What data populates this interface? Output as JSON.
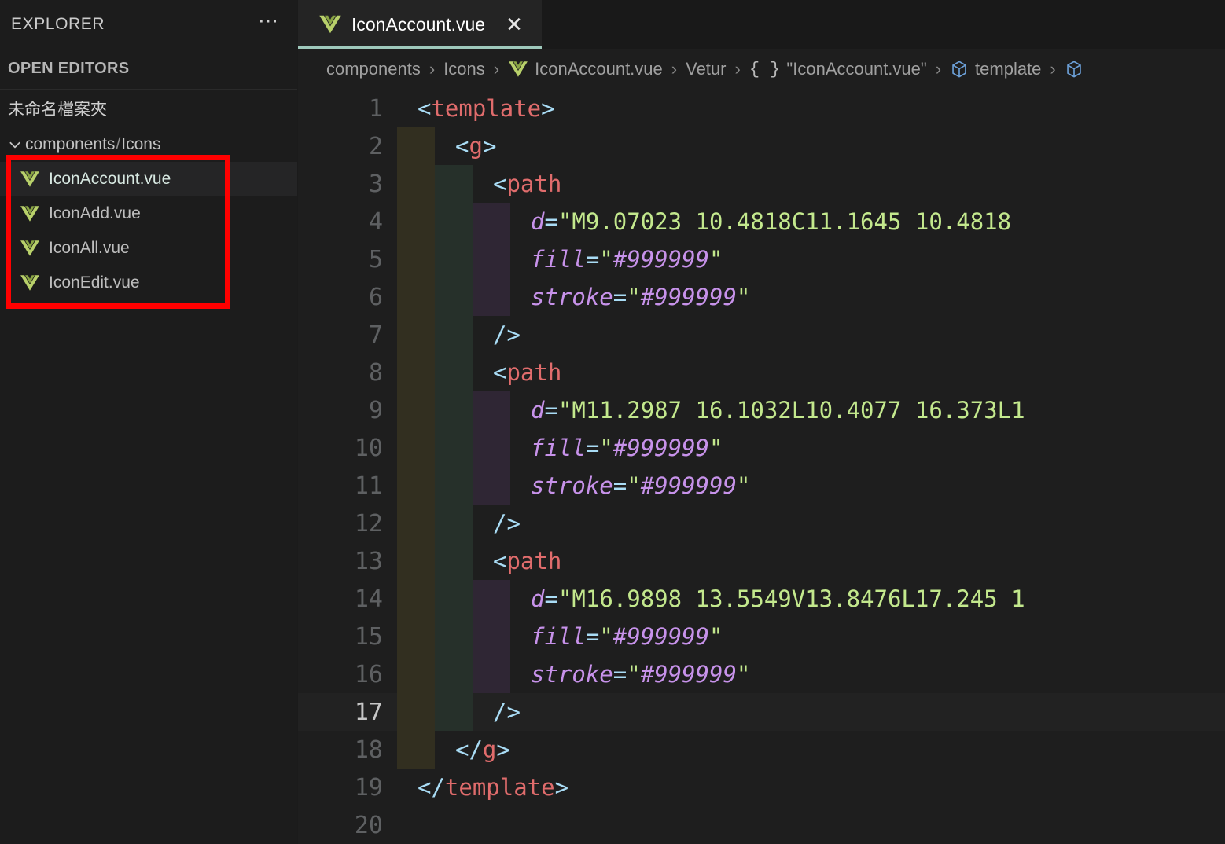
{
  "sidebar": {
    "title": "EXPLORER",
    "more_icon": "ellipsis-icon",
    "open_editors_label": "OPEN EDITORS",
    "workspace_label": "未命名檔案夾",
    "group": {
      "name": "components",
      "separator": "/",
      "subname": "Icons"
    },
    "files": [
      {
        "name": "IconAccount.vue",
        "icon": "vue-icon",
        "selected": true
      },
      {
        "name": "IconAdd.vue",
        "icon": "vue-icon",
        "selected": false
      },
      {
        "name": "IconAll.vue",
        "icon": "vue-icon",
        "selected": false
      },
      {
        "name": "IconEdit.vue",
        "icon": "vue-icon",
        "selected": false
      }
    ]
  },
  "annotation": {
    "shape": "rectangle",
    "color": "#ff0000"
  },
  "tab": {
    "label": "IconAccount.vue",
    "icon": "vue-icon",
    "close_icon": "✕",
    "active_border_color": "#9fc9bc"
  },
  "breadcrumbs": [
    {
      "label": "components",
      "icon": null
    },
    {
      "label": "Icons",
      "icon": null
    },
    {
      "label": "IconAccount.vue",
      "icon": "vue-icon"
    },
    {
      "label": "Vetur",
      "icon": null
    },
    {
      "label": "\"IconAccount.vue\"",
      "icon": "braces-icon"
    },
    {
      "label": "template",
      "icon": "cube-icon"
    },
    {
      "label": "",
      "icon": "cube-icon"
    }
  ],
  "breadcrumb_separator": "›",
  "editor": {
    "active_line": 17,
    "total_lines_visible": 20,
    "lines": [
      {
        "n": 1,
        "indent": 0,
        "tokens": [
          {
            "c": "t-bracket",
            "t": "<"
          },
          {
            "c": "t-tag",
            "t": "template"
          },
          {
            "c": "t-bracket",
            "t": ">"
          }
        ]
      },
      {
        "n": 2,
        "indent": 1,
        "tokens": [
          {
            "c": "t-bracket",
            "t": "<"
          },
          {
            "c": "t-tag",
            "t": "g"
          },
          {
            "c": "t-bracket",
            "t": ">"
          }
        ]
      },
      {
        "n": 3,
        "indent": 2,
        "tokens": [
          {
            "c": "t-bracket",
            "t": "<"
          },
          {
            "c": "t-tag",
            "t": "path"
          }
        ]
      },
      {
        "n": 4,
        "indent": 3,
        "tokens": [
          {
            "c": "t-attr",
            "t": "d"
          },
          {
            "c": "t-eq",
            "t": "="
          },
          {
            "c": "t-str",
            "t": "\"M9.07023 10.4818C11.1645 10.4818"
          }
        ]
      },
      {
        "n": 5,
        "indent": 3,
        "tokens": [
          {
            "c": "t-attr",
            "t": "fill"
          },
          {
            "c": "t-eq",
            "t": "="
          },
          {
            "c": "t-quote",
            "t": "\""
          },
          {
            "c": "t-strpur",
            "t": "#999999"
          },
          {
            "c": "t-quote",
            "t": "\""
          }
        ]
      },
      {
        "n": 6,
        "indent": 3,
        "tokens": [
          {
            "c": "t-attr",
            "t": "stroke"
          },
          {
            "c": "t-eq",
            "t": "="
          },
          {
            "c": "t-quote",
            "t": "\""
          },
          {
            "c": "t-strpur",
            "t": "#999999"
          },
          {
            "c": "t-quote",
            "t": "\""
          }
        ]
      },
      {
        "n": 7,
        "indent": 2,
        "tokens": [
          {
            "c": "t-bracket",
            "t": "/>"
          }
        ]
      },
      {
        "n": 8,
        "indent": 2,
        "tokens": [
          {
            "c": "t-bracket",
            "t": "<"
          },
          {
            "c": "t-tag",
            "t": "path"
          }
        ]
      },
      {
        "n": 9,
        "indent": 3,
        "tokens": [
          {
            "c": "t-attr",
            "t": "d"
          },
          {
            "c": "t-eq",
            "t": "="
          },
          {
            "c": "t-str",
            "t": "\"M11.2987 16.1032L10.4077 16.373L1"
          }
        ]
      },
      {
        "n": 10,
        "indent": 3,
        "tokens": [
          {
            "c": "t-attr",
            "t": "fill"
          },
          {
            "c": "t-eq",
            "t": "="
          },
          {
            "c": "t-quote",
            "t": "\""
          },
          {
            "c": "t-strpur",
            "t": "#999999"
          },
          {
            "c": "t-quote",
            "t": "\""
          }
        ]
      },
      {
        "n": 11,
        "indent": 3,
        "tokens": [
          {
            "c": "t-attr",
            "t": "stroke"
          },
          {
            "c": "t-eq",
            "t": "="
          },
          {
            "c": "t-quote",
            "t": "\""
          },
          {
            "c": "t-strpur",
            "t": "#999999"
          },
          {
            "c": "t-quote",
            "t": "\""
          }
        ]
      },
      {
        "n": 12,
        "indent": 2,
        "tokens": [
          {
            "c": "t-bracket",
            "t": "/>"
          }
        ]
      },
      {
        "n": 13,
        "indent": 2,
        "tokens": [
          {
            "c": "t-bracket",
            "t": "<"
          },
          {
            "c": "t-tag",
            "t": "path"
          }
        ]
      },
      {
        "n": 14,
        "indent": 3,
        "tokens": [
          {
            "c": "t-attr",
            "t": "d"
          },
          {
            "c": "t-eq",
            "t": "="
          },
          {
            "c": "t-str",
            "t": "\"M16.9898 13.5549V13.8476L17.245 1"
          }
        ]
      },
      {
        "n": 15,
        "indent": 3,
        "tokens": [
          {
            "c": "t-attr",
            "t": "fill"
          },
          {
            "c": "t-eq",
            "t": "="
          },
          {
            "c": "t-quote",
            "t": "\""
          },
          {
            "c": "t-strpur",
            "t": "#999999"
          },
          {
            "c": "t-quote",
            "t": "\""
          }
        ]
      },
      {
        "n": 16,
        "indent": 3,
        "tokens": [
          {
            "c": "t-attr",
            "t": "stroke"
          },
          {
            "c": "t-eq",
            "t": "="
          },
          {
            "c": "t-quote",
            "t": "\""
          },
          {
            "c": "t-strpur",
            "t": "#999999"
          },
          {
            "c": "t-quote",
            "t": "\""
          }
        ]
      },
      {
        "n": 17,
        "indent": 2,
        "tokens": [
          {
            "c": "t-bracket",
            "t": "/>"
          }
        ]
      },
      {
        "n": 18,
        "indent": 1,
        "tokens": [
          {
            "c": "t-bracket",
            "t": "</"
          },
          {
            "c": "t-tag",
            "t": "g"
          },
          {
            "c": "t-bracket",
            "t": ">"
          }
        ]
      },
      {
        "n": 19,
        "indent": 0,
        "tokens": [
          {
            "c": "t-bracket",
            "t": "</"
          },
          {
            "c": "t-tag",
            "t": "template"
          },
          {
            "c": "t-bracket",
            "t": ">"
          }
        ]
      },
      {
        "n": 20,
        "indent": 0,
        "tokens": []
      }
    ]
  },
  "colors": {
    "background": "#1e1e1e",
    "sidebar_background": "#1c1c1c",
    "tab_active_background": "#242424",
    "tag": "#e06c6c",
    "bracket": "#a9dcf5",
    "attribute": "#c792ea",
    "string": "#c3e88d",
    "annotation": "#ff0000",
    "vue_green": "#b8d06a"
  }
}
